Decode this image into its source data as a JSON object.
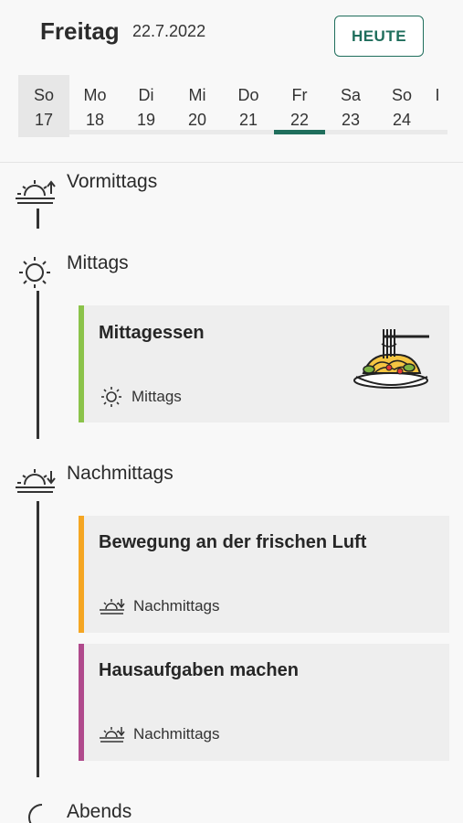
{
  "header": {
    "weekday": "Freitag",
    "date": "22.7.2022",
    "today_button": "HEUTE"
  },
  "week": [
    {
      "name": "So",
      "num": "17"
    },
    {
      "name": "Mo",
      "num": "18"
    },
    {
      "name": "Di",
      "num": "19"
    },
    {
      "name": "Mi",
      "num": "20"
    },
    {
      "name": "Do",
      "num": "21"
    },
    {
      "name": "Fr",
      "num": "22"
    },
    {
      "name": "Sa",
      "num": "23"
    },
    {
      "name": "So",
      "num": "24"
    },
    {
      "name": "I",
      "num": ""
    }
  ],
  "selected_day_index": 5,
  "sections": {
    "vormittags": "Vormittags",
    "mittags": "Mittags",
    "nachmittags": "Nachmittags",
    "abends": "Abends"
  },
  "cards": [
    {
      "title": "Mittagessen",
      "time": "Mittags",
      "color": "#8bc34a",
      "icon": "sun-icon",
      "image": "spaghetti-plate-icon"
    },
    {
      "title": "Bewegung an der frischen Luft",
      "time": "Nachmittags",
      "color": "#f5a623",
      "icon": "sunset-icon"
    },
    {
      "title": "Hausaufgaben machen",
      "time": "Nachmittags",
      "color": "#b04a8c",
      "icon": "sunset-icon"
    }
  ],
  "colors": {
    "accent": "#1f6e5c",
    "background": "#f8f8f8",
    "card": "#eeeeee"
  }
}
